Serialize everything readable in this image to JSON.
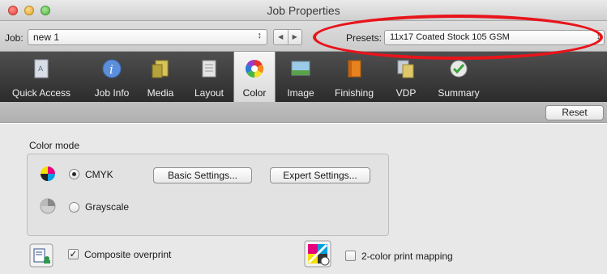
{
  "window": {
    "title": "Job Properties"
  },
  "jobbar": {
    "job_label": "Job:",
    "job_value": "new  1",
    "presets_label": "Presets:",
    "presets_value": "11x17 Coated Stock 105 GSM"
  },
  "toolbar": {
    "tabs": [
      {
        "label": "Quick Access",
        "icon": "quick-access-icon"
      },
      {
        "label": "Job Info",
        "icon": "info-icon"
      },
      {
        "label": "Media",
        "icon": "media-icon"
      },
      {
        "label": "Layout",
        "icon": "layout-icon"
      },
      {
        "label": "Color",
        "icon": "color-wheel-icon",
        "active": true
      },
      {
        "label": "Image",
        "icon": "image-icon"
      },
      {
        "label": "Finishing",
        "icon": "finishing-icon"
      },
      {
        "label": "VDP",
        "icon": "vdp-icon"
      },
      {
        "label": "Summary",
        "icon": "summary-check-icon"
      }
    ]
  },
  "band": {
    "reset_label": "Reset"
  },
  "color": {
    "section_label": "Color mode",
    "cmyk_label": "CMYK",
    "grayscale_label": "Grayscale",
    "selected_mode": "CMYK",
    "basic_settings_label": "Basic Settings...",
    "expert_settings_label": "Expert Settings...",
    "composite_overprint_label": "Composite overprint",
    "composite_overprint_checked": true,
    "two_color_label": "2-color print mapping",
    "two_color_checked": false
  },
  "colors": {
    "highlight_oval": "#e8141b",
    "toolbar_bg": "#3a3a3a"
  }
}
